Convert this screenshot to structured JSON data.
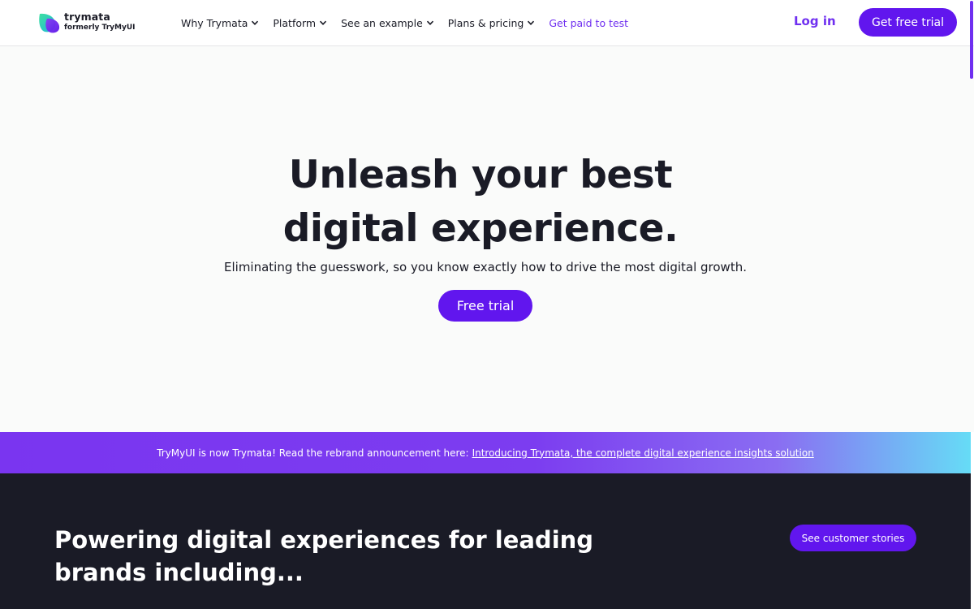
{
  "header": {
    "logo": {
      "name": "trymata",
      "subtitle": "formerly TryMyUI",
      "icon": "leaf-logo-icon"
    },
    "nav": [
      {
        "label": "Why Trymata",
        "dropdown": true
      },
      {
        "label": "Platform",
        "dropdown": true
      },
      {
        "label": "See an example",
        "dropdown": true
      },
      {
        "label": "Plans & pricing",
        "dropdown": true
      },
      {
        "label": "Get paid to test",
        "dropdown": false
      }
    ],
    "login_label": "Log in",
    "cta_label": "Get free trial"
  },
  "hero": {
    "title_line1": "Unleash your best",
    "title_line2": "digital experience.",
    "subtitle": "Eliminating the guesswork, so you know exactly how to drive the most digital growth.",
    "cta_label": "Free trial"
  },
  "banner": {
    "text": "TryMyUI is now Trymata! Read the rebrand announcement here:",
    "link_text": "Introducing Trymata, the complete digital experience insights solution"
  },
  "brands": {
    "title": "Powering digital experiences for leading brands including...",
    "cta_label": "See customer stories"
  },
  "colors": {
    "brand_purple": "#6116ee",
    "accent_text": "#6f2ff0",
    "dark_bg": "#1a1b26",
    "banner_end": "#66dcf6"
  }
}
